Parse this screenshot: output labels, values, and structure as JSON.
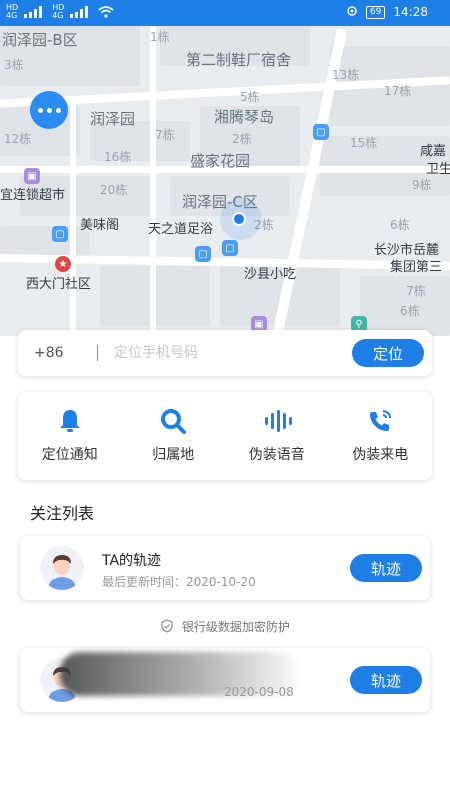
{
  "status_bar": {
    "time": "14:28",
    "battery": "69",
    "signal": "4G"
  },
  "map": {
    "labels": {
      "a": "润泽园-B区",
      "b": "第二制鞋厂宿舍",
      "c": "润泽园",
      "d": "湘腾琴岛",
      "e": "盛家花园",
      "f": "润泽园-C区",
      "g": "宜连锁超市",
      "h": "美味阁",
      "i": "天之道足浴",
      "j": "沙县小吃",
      "k": "西大门社区",
      "l": "长沙市岳麓",
      "m": "集团第三",
      "n": "咸嘉",
      "o": "卫生"
    },
    "buildings": {
      "b1": "1栋",
      "b2": "3栋",
      "b3": "13栋",
      "b4": "17栋",
      "b5": "5栋",
      "b6": "7栋",
      "b7": "2栋",
      "b8": "16栋",
      "b9": "15栋",
      "b10": "20栋",
      "b11": "6栋",
      "b12": "2栋",
      "b13": "12栋",
      "b14": "7栋",
      "b15": "6栋",
      "b16": "9栋"
    }
  },
  "search": {
    "prefix": "+86",
    "placeholder": "定位手机号码",
    "button": "定位"
  },
  "actions": [
    {
      "label": "定位通知",
      "icon": "bell-icon"
    },
    {
      "label": "归属地",
      "icon": "search-icon"
    },
    {
      "label": "伪装语音",
      "icon": "voice-wave-icon"
    },
    {
      "label": "伪装来电",
      "icon": "phone-call-icon"
    }
  ],
  "follow": {
    "title": "关注列表",
    "items": [
      {
        "name": "TA的轨迹",
        "time": "最后更新时间：2020-10-20",
        "button": "轨迹"
      },
      {
        "name": "",
        "time": "2020-09-08",
        "button": "轨迹"
      }
    ],
    "security_note": "银行级数据加密防护"
  },
  "colors": {
    "accent": "#1e7fe6",
    "status_bar": "#1e7fe6"
  }
}
